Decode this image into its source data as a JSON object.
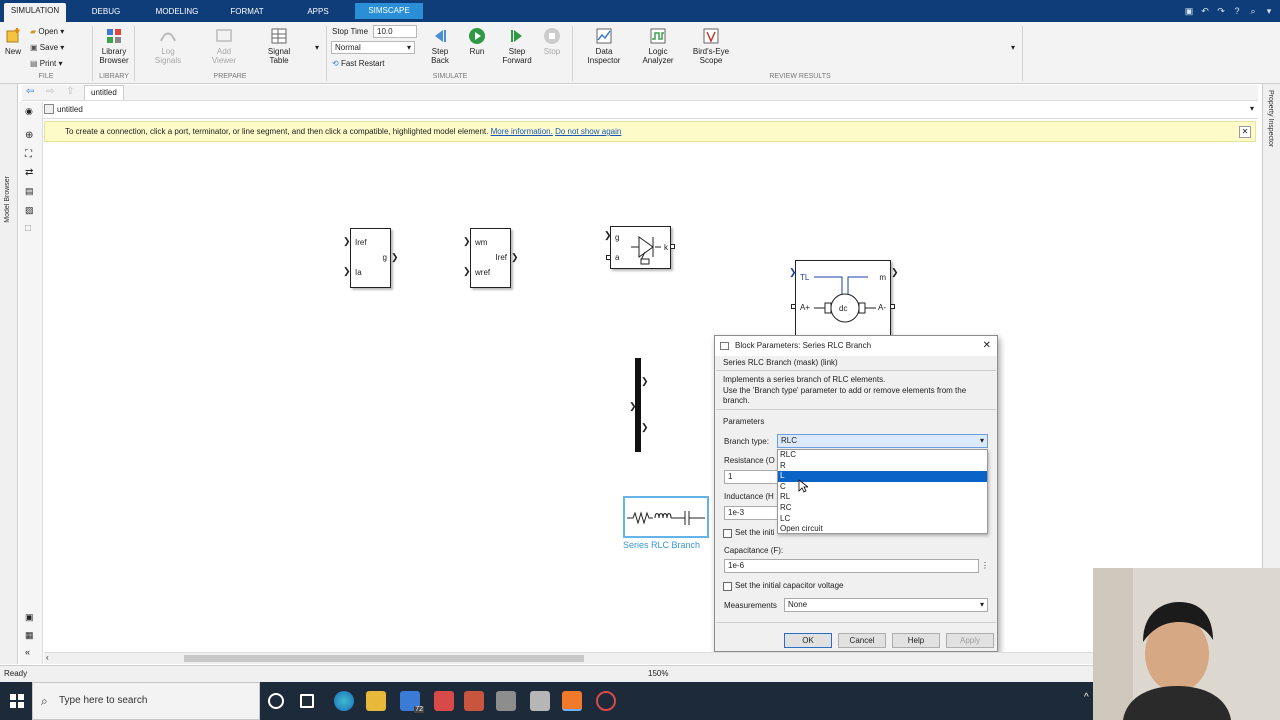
{
  "tabs": [
    {
      "label": "SIMULATION",
      "active": true
    },
    {
      "label": "DEBUG"
    },
    {
      "label": "MODELING"
    },
    {
      "label": "FORMAT"
    },
    {
      "label": "APPS"
    },
    {
      "label": "SIMSCAPE BLOCK",
      "contextual": true
    }
  ],
  "ribbon": {
    "new_label": "New",
    "open_label": "Open",
    "save_label": "Save",
    "print_label": "Print",
    "library_browser_label": "Library Browser",
    "log_signals_label": "Log Signals",
    "add_viewer_label": "Add Viewer",
    "signal_table_label": "Signal Table",
    "stop_time_label": "Stop Time",
    "stop_time_value": "10.0",
    "mode_value": "Normal",
    "fast_restart_label": "Fast Restart",
    "step_back_label": "Step Back",
    "run_label": "Run",
    "step_forward_label": "Step Forward",
    "stop_label": "Stop",
    "data_inspector_label": "Data Inspector",
    "logic_analyzer_label": "Logic Analyzer",
    "birds_eye_label": "Bird's-Eye Scope",
    "sections": {
      "file": "FILE",
      "library": "LIBRARY",
      "prepare": "PREPARE",
      "simulate": "SIMULATE",
      "review": "REVIEW RESULTS"
    }
  },
  "breadcrumb_tab": "untitled",
  "model_path": "untitled",
  "side_labels": {
    "left": "Model Browser",
    "right": "Property Inspector"
  },
  "banner": {
    "text": "To create a connection, click a port, terminator, or line segment, and then click a compatible, highlighted model element.",
    "link1": "More information.",
    "link2": "Do not show again"
  },
  "blocks": {
    "b1": {
      "in1": "Iref",
      "in2": "Ia",
      "out": "g"
    },
    "b2": {
      "in1": "wm",
      "in2": "wref",
      "out": "Iref"
    },
    "b3": {
      "g": "g",
      "a": "a",
      "k": "k"
    },
    "motor": {
      "tl": "TL",
      "m": "m",
      "ap": "A+",
      "am": "A-",
      "center": "dc"
    },
    "rlc_label": "Series RLC Branch"
  },
  "dialog": {
    "title": "Block Parameters: Series RLC Branch",
    "subtitle": "Series RLC Branch (mask) (link)",
    "desc1": "Implements a series branch of RLC elements.",
    "desc2": "Use the 'Branch type' parameter to add or remove elements from the branch.",
    "params_label": "Parameters",
    "branch_type_label": "Branch type:",
    "branch_type_value": "RLC",
    "resistance_label": "Resistance (O",
    "resistance_value": "1",
    "inductance_label": "Inductance (H",
    "inductance_value": "1e-3",
    "set_current_label": "Set the initi",
    "capacitance_label": "Capacitance (F):",
    "capacitance_value": "1e-6",
    "set_voltage_label": "Set the initial capacitor voltage",
    "measurements_label": "Measurements",
    "measurements_value": "None",
    "ok": "OK",
    "cancel": "Cancel",
    "help": "Help",
    "apply": "Apply",
    "options": [
      "RLC",
      "R",
      "L",
      "C",
      "RL",
      "RC",
      "LC",
      "Open circuit"
    ],
    "selected_option": "L"
  },
  "status": {
    "left": "Ready",
    "zoom": "150%"
  },
  "taskbar": {
    "search_placeholder": "Type here to search",
    "badge": "72"
  }
}
